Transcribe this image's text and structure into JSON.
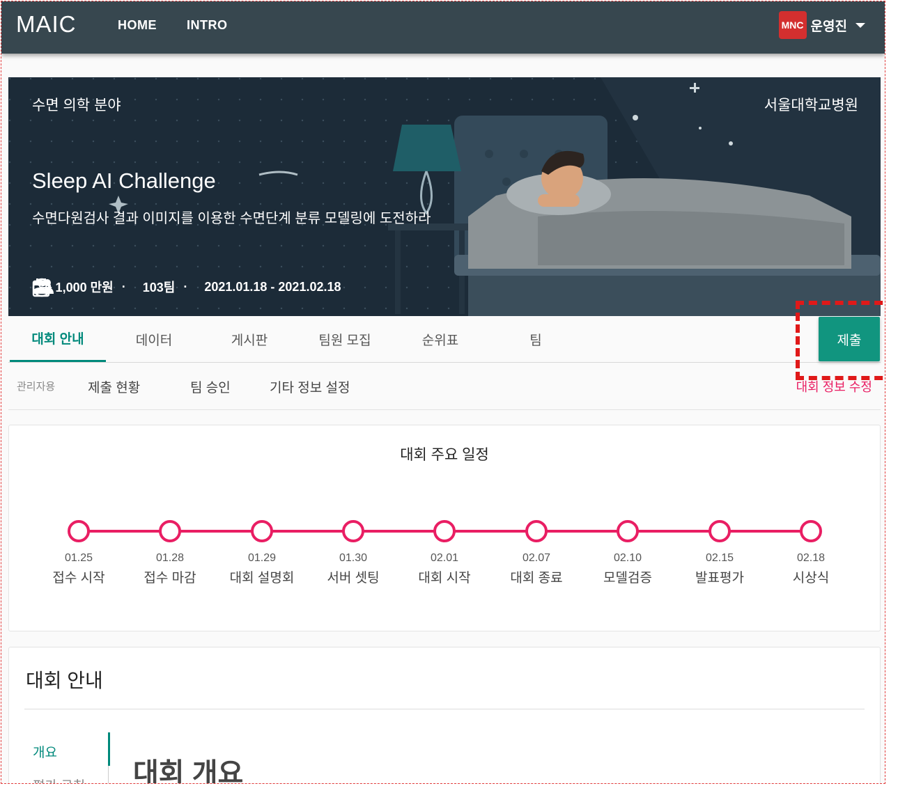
{
  "nav": {
    "logo": "MAIC",
    "links": [
      "HOME",
      "INTRO"
    ],
    "user_badge": "MNC",
    "user_name": "운영진"
  },
  "hero": {
    "category": "수면 의학 분야",
    "host": "서울대학교병원",
    "title": "Sleep AI Challenge",
    "subtitle": "수면다원검사 결과 이미지를 이용한 수면단계 분류 모델링에 도전하라",
    "prize": "총 1,000 만원",
    "teams": "103팀",
    "period": "2021.01.18 - 2021.02.18"
  },
  "tabs": [
    "대회 안내",
    "데이터",
    "게시판",
    "팀원 모집",
    "순위표",
    "팀"
  ],
  "active_tab": "대회 안내",
  "submit_label": "제출",
  "admin": {
    "label": "관리자용",
    "items": [
      "제출 현황",
      "팀 승인",
      "기타 정보 설정"
    ],
    "edit_label": "대회 정보 수정"
  },
  "schedule": {
    "title": "대회 주요 일정",
    "events": [
      {
        "date": "01.25",
        "label": "접수 시작"
      },
      {
        "date": "01.28",
        "label": "접수 마감"
      },
      {
        "date": "01.29",
        "label": "대회 설명회"
      },
      {
        "date": "01.30",
        "label": "서버 셋팅"
      },
      {
        "date": "02.01",
        "label": "대회 시작"
      },
      {
        "date": "02.07",
        "label": "대회 종료"
      },
      {
        "date": "02.10",
        "label": "모델검증"
      },
      {
        "date": "02.15",
        "label": "발표평가"
      },
      {
        "date": "02.18",
        "label": "시상식"
      }
    ]
  },
  "intro": {
    "title": "대회 안내",
    "side_items": [
      "개요",
      "평가 규칙"
    ],
    "heading": "대회 개요"
  },
  "colors": {
    "topbar": "#37474f",
    "accent": "#00897b",
    "timeline": "#e91e63",
    "highlight": "#e01919"
  }
}
